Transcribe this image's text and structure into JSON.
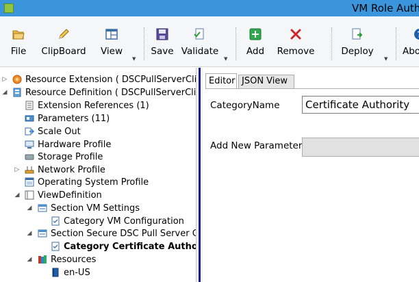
{
  "window": {
    "title": "VM Role Authoring Tool"
  },
  "ribbon": {
    "buttons": [
      {
        "label": "File",
        "icon": "folder-open-icon",
        "has_dropdown": false
      },
      {
        "label": "ClipBoard",
        "icon": "pencil-icon",
        "has_dropdown": false
      },
      {
        "label": "View",
        "icon": "window-layout-icon",
        "has_dropdown": true
      },
      {
        "label": "Save",
        "icon": "floppy-disk-icon",
        "has_dropdown": false
      },
      {
        "label": "Validate",
        "icon": "validate-document-icon",
        "has_dropdown": true
      },
      {
        "label": "Add",
        "icon": "green-plus-icon",
        "has_dropdown": false
      },
      {
        "label": "Remove",
        "icon": "red-x-icon",
        "has_dropdown": false
      },
      {
        "label": "Deploy",
        "icon": "deploy-document-icon",
        "has_dropdown": true
      },
      {
        "label": "About",
        "icon": "help-question-icon",
        "has_dropdown": false
      }
    ]
  },
  "tree": {
    "nodes": [
      {
        "label": "Resource Extension ( DSCPullServerClient",
        "icon": "resource-extension-icon",
        "expander": "collapsed"
      },
      {
        "label": "Resource Definition ( DSCPullServerClient",
        "icon": "resource-definition-icon",
        "expander": "expanded"
      },
      {
        "label": "Extension References (1)",
        "icon": "extension-references-icon",
        "expander": "none"
      },
      {
        "label": "Parameters (11)",
        "icon": "parameters-icon",
        "expander": "none"
      },
      {
        "label": "Scale Out",
        "icon": "scale-out-icon",
        "expander": "none"
      },
      {
        "label": "Hardware Profile",
        "icon": "hardware-profile-icon",
        "expander": "none"
      },
      {
        "label": "Storage Profile",
        "icon": "storage-profile-icon",
        "expander": "none"
      },
      {
        "label": "Network Profile",
        "icon": "network-profile-icon",
        "expander": "collapsed"
      },
      {
        "label": "Operating System Profile",
        "icon": "os-profile-icon",
        "expander": "none"
      },
      {
        "label": "ViewDefinition",
        "icon": "view-definition-icon",
        "expander": "expanded"
      },
      {
        "label": "Section VM Settings",
        "icon": "section-icon",
        "expander": "expanded"
      },
      {
        "label": "Category VM Configuration",
        "icon": "category-icon",
        "expander": "none"
      },
      {
        "label": "Section Secure DSC Pull Server Client",
        "icon": "section-icon",
        "expander": "expanded"
      },
      {
        "label": "Category Certificate Authority",
        "icon": "category-icon",
        "expander": "none",
        "selected": true
      },
      {
        "label": "Resources",
        "icon": "books-icon",
        "expander": "expanded"
      },
      {
        "label": "en-US",
        "icon": "book-icon",
        "expander": "none"
      }
    ]
  },
  "editor": {
    "tabs": [
      {
        "label": "Editor",
        "active": true
      },
      {
        "label": "JSON View",
        "active": false
      }
    ],
    "category_name_label": "CategoryName",
    "category_name_value": "Certificate Authority",
    "add_new_parameter_label": "Add New Parameter"
  }
}
